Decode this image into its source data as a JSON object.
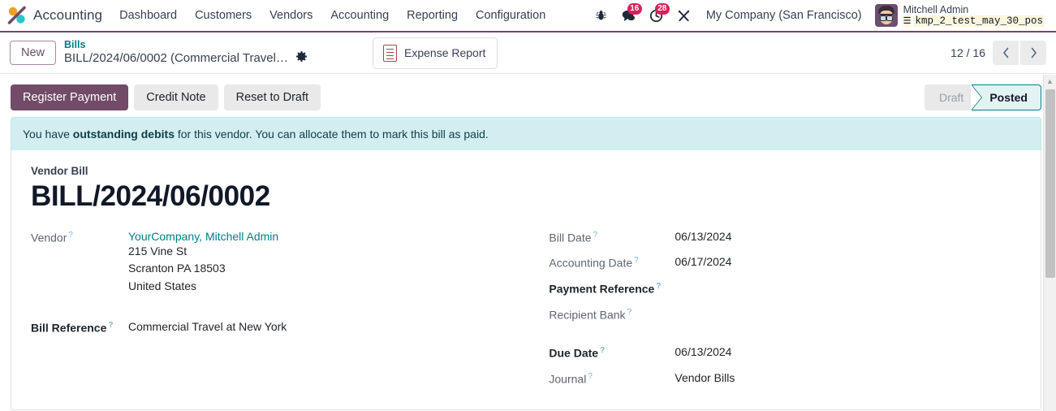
{
  "navbar": {
    "brand": "Accounting",
    "logo_icon": "odoo-logo",
    "menu_items": [
      {
        "label": "Dashboard"
      },
      {
        "label": "Customers"
      },
      {
        "label": "Vendors"
      },
      {
        "label": "Accounting"
      },
      {
        "label": "Reporting"
      },
      {
        "label": "Configuration"
      }
    ],
    "systray": {
      "debug_icon": "bug-icon",
      "messages_icon": "chat-bubble-icon",
      "messages_count": "16",
      "activities_icon": "clock-icon",
      "activities_count": "28",
      "tools_icon": "wrench-screwdriver-icon",
      "company": "My Company (San Francisco)",
      "user_name": "Mitchell Admin",
      "database_icon": "database-icon",
      "database_name": "kmp_2_test_may_30_pos",
      "avatar": "user-avatar"
    },
    "accent_color": "#714B67"
  },
  "control_panel": {
    "new_button": "New",
    "breadcrumb_parent": "Bills",
    "breadcrumb_current": "BILL/2024/06/0002 (Commercial Travel…",
    "settings_icon": "gear-icon",
    "smart_button": {
      "label": "Expense Report",
      "icon": "document-icon"
    },
    "pager": {
      "text": "12 / 16",
      "prev_icon": "chevron-left-icon",
      "next_icon": "chevron-right-icon"
    }
  },
  "actions": {
    "register_payment": "Register Payment",
    "credit_note": "Credit Note",
    "reset_to_draft": "Reset to Draft"
  },
  "statusbar": {
    "stages": [
      {
        "label": "Draft",
        "active": false
      },
      {
        "label": "Posted",
        "active": true
      }
    ],
    "active_color": "#017e84"
  },
  "alert": {
    "text_before": "You have ",
    "text_bold": "outstanding debits",
    "text_after": " for this vendor. You can allocate them to mark this bill as paid.",
    "background": "#d3eef1"
  },
  "form": {
    "doc_type_label": "Vendor Bill",
    "title": "BILL/2024/06/0002",
    "left_fields": [
      {
        "label": "Vendor",
        "required": false,
        "help": "?",
        "value": "YourCompany, Mitchell Admin",
        "is_link": true,
        "address": [
          "215 Vine St",
          "Scranton PA 18503",
          "United States"
        ]
      },
      {
        "label": "Bill Reference",
        "required": true,
        "help": "?",
        "value": "Commercial Travel at New York",
        "is_link": false
      }
    ],
    "right_fields": [
      {
        "label": "Bill Date",
        "required": false,
        "help": "?",
        "value": "06/13/2024"
      },
      {
        "label": "Accounting Date",
        "required": false,
        "help": "?",
        "value": "06/17/2024"
      },
      {
        "label": "Payment Reference",
        "required": true,
        "help": "?",
        "value": ""
      },
      {
        "label": "Recipient Bank",
        "required": false,
        "help": "?",
        "value": ""
      },
      {
        "label": "Due Date",
        "required": true,
        "help": "?",
        "value": "06/13/2024"
      },
      {
        "label": "Journal",
        "required": false,
        "help": "?",
        "value": "Vendor Bills"
      }
    ]
  }
}
